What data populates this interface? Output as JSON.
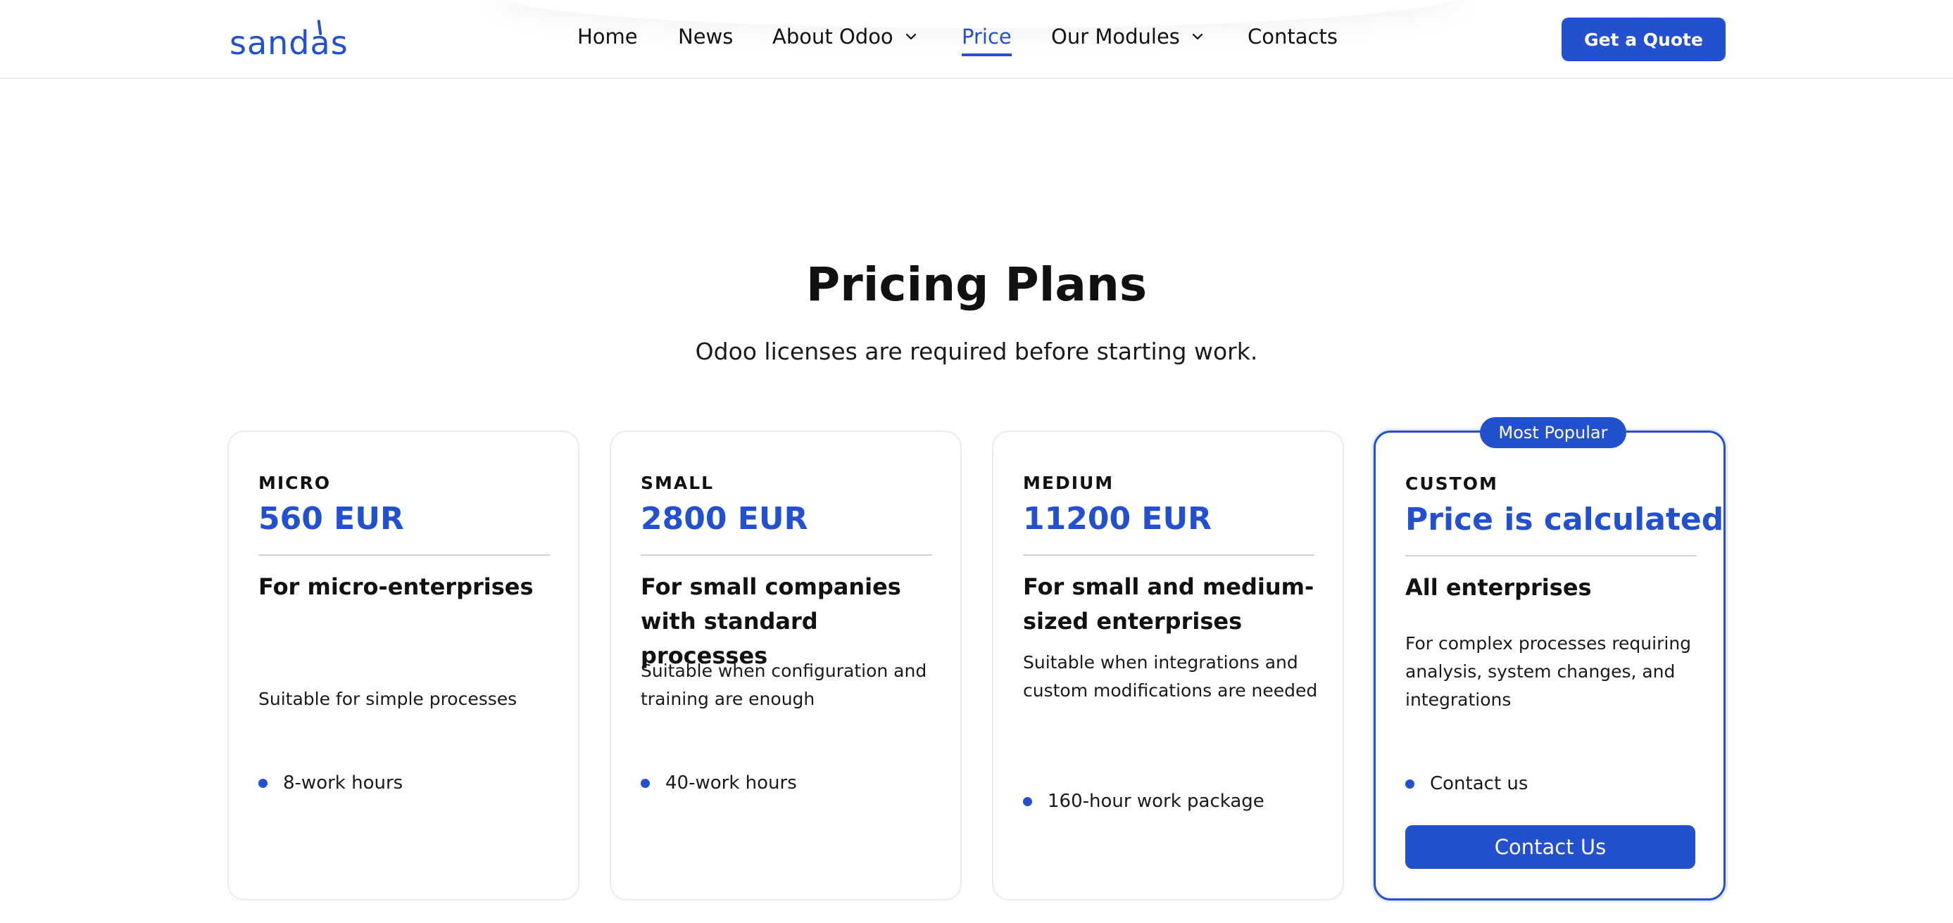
{
  "header": {
    "logo_text": "sandas",
    "nav": [
      {
        "label": "Home"
      },
      {
        "label": "News"
      },
      {
        "label": "About Odoo",
        "has_dropdown": true
      },
      {
        "label": "Price",
        "active": true
      },
      {
        "label": "Our Modules",
        "has_dropdown": true
      },
      {
        "label": "Contacts"
      }
    ],
    "cta_label": "Get a Quote"
  },
  "pricing": {
    "title": "Pricing Plans",
    "subtitle": "Odoo licenses are required before starting work.",
    "plans": [
      {
        "tier": "MICRO",
        "price": "560 EUR",
        "audience": "For micro-enterprises",
        "description": "Suitable for simple processes",
        "feature": "8-work hours"
      },
      {
        "tier": "SMALL",
        "price": "2800 EUR",
        "audience": "For small companies with standard processes",
        "description": "Suitable when configuration and training are enough",
        "feature": "40-work hours"
      },
      {
        "tier": "MEDIUM",
        "price": "11200 EUR",
        "audience": "For small and medium-sized enterprises",
        "description": "Suitable when integrations and custom modifications are needed",
        "feature": "160-hour work package"
      },
      {
        "tier": "CUSTOM",
        "price": "Price is calculated",
        "audience": "All enterprises",
        "description": "For complex processes requiring analysis, system changes, and integrations",
        "feature": "Contact us",
        "badge": "Most Popular",
        "button_label": "Contact Us"
      }
    ]
  },
  "colors": {
    "accent": "#2350cf",
    "text": "#111111",
    "border": "#ececec"
  }
}
